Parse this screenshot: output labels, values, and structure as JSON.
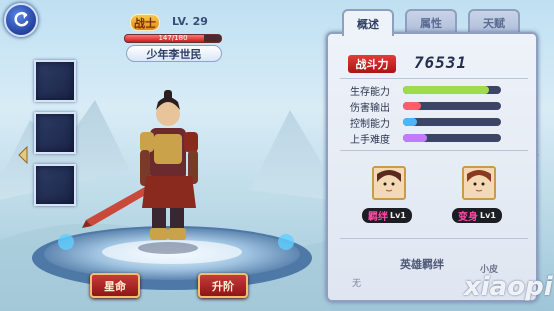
{
  "hero": {
    "class_tag": "战士",
    "level": "LV. 29",
    "hp_text": "147/180",
    "hp_fraction": 0.82,
    "name": "少年李世民"
  },
  "tabs": [
    {
      "label": "概述",
      "active": true
    },
    {
      "label": "属性",
      "active": false
    },
    {
      "label": "天赋",
      "active": false
    }
  ],
  "power": {
    "label": "战斗力",
    "value": "76531"
  },
  "stats": [
    {
      "label": "生存能力",
      "fraction": 0.88,
      "color": "#9fdc4a"
    },
    {
      "label": "伤害输出",
      "fraction": 0.18,
      "color": "#ff5c6c"
    },
    {
      "label": "控制能力",
      "fraction": 0.14,
      "color": "#4ab6ff"
    },
    {
      "label": "上手难度",
      "fraction": 0.24,
      "color": "#c07cff"
    }
  ],
  "relations": [
    {
      "label": "羁绊",
      "level": "Lv1"
    },
    {
      "label": "变身",
      "level": "Lv1"
    }
  ],
  "bond": {
    "title": "英雄羁绊",
    "value": "无"
  },
  "buttons": {
    "left": "星命",
    "right": "升阶"
  },
  "watermark": {
    "small": "小皮",
    "big": "xiaopi"
  },
  "colors": {
    "accent_red": "#c83a3a",
    "panel_border": "#8e9fbf"
  }
}
